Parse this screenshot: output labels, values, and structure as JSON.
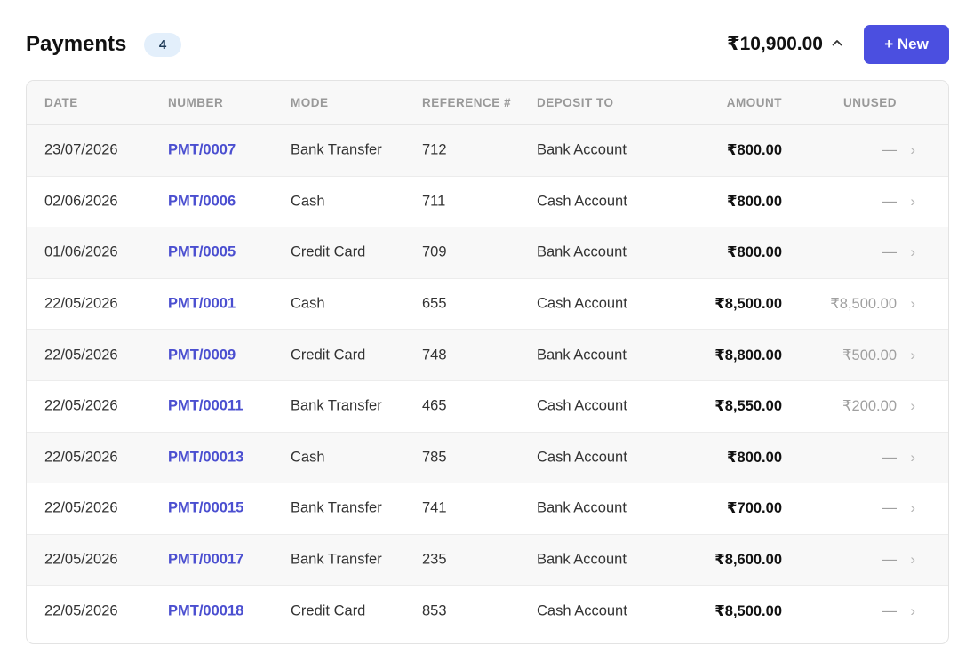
{
  "header": {
    "title": "Payments",
    "count": "4",
    "total": "₹10,900.00",
    "new_button_label": "+ New"
  },
  "columns": [
    "DATE",
    "NUMBER",
    "MODE",
    "REFERENCE #",
    "DEPOSIT TO",
    "AMOUNT",
    "UNUSED"
  ],
  "rows": [
    {
      "date": "23/07/2026",
      "number": "PMT/0007",
      "mode": "Bank Transfer",
      "reference": "712",
      "deposit_to": "Bank Account",
      "amount": "₹800.00",
      "unused": "—"
    },
    {
      "date": "02/06/2026",
      "number": "PMT/0006",
      "mode": "Cash",
      "reference": "711",
      "deposit_to": "Cash Account",
      "amount": "₹800.00",
      "unused": "—"
    },
    {
      "date": "01/06/2026",
      "number": "PMT/0005",
      "mode": "Credit Card",
      "reference": "709",
      "deposit_to": "Bank Account",
      "amount": "₹800.00",
      "unused": "—"
    },
    {
      "date": "22/05/2026",
      "number": "PMT/0001",
      "mode": "Cash",
      "reference": "655",
      "deposit_to": "Cash Account",
      "amount": "₹8,500.00",
      "unused": "₹8,500.00"
    },
    {
      "date": "22/05/2026",
      "number": "PMT/0009",
      "mode": "Credit Card",
      "reference": "748",
      "deposit_to": "Bank Account",
      "amount": "₹8,800.00",
      "unused": "₹500.00"
    },
    {
      "date": "22/05/2026",
      "number": "PMT/00011",
      "mode": "Bank Transfer",
      "reference": "465",
      "deposit_to": "Cash Account",
      "amount": "₹8,550.00",
      "unused": "₹200.00"
    },
    {
      "date": "22/05/2026",
      "number": "PMT/00013",
      "mode": "Cash",
      "reference": "785",
      "deposit_to": "Cash Account",
      "amount": "₹800.00",
      "unused": "—"
    },
    {
      "date": "22/05/2026",
      "number": "PMT/00015",
      "mode": "Bank Transfer",
      "reference": "741",
      "deposit_to": "Bank Account",
      "amount": "₹700.00",
      "unused": "—"
    },
    {
      "date": "22/05/2026",
      "number": "PMT/00017",
      "mode": "Bank Transfer",
      "reference": "235",
      "deposit_to": "Bank Account",
      "amount": "₹8,600.00",
      "unused": "—"
    },
    {
      "date": "22/05/2026",
      "number": "PMT/00018",
      "mode": "Credit Card",
      "reference": "853",
      "deposit_to": "Cash Account",
      "amount": "₹8,500.00",
      "unused": "—"
    }
  ],
  "icons": {
    "total_toggle": "chevron-up-icon",
    "row_open": "chevron-right-icon"
  },
  "colors": {
    "accent": "#4b4fe0",
    "link": "#4b4fd0",
    "badge_bg": "#e3effb"
  }
}
